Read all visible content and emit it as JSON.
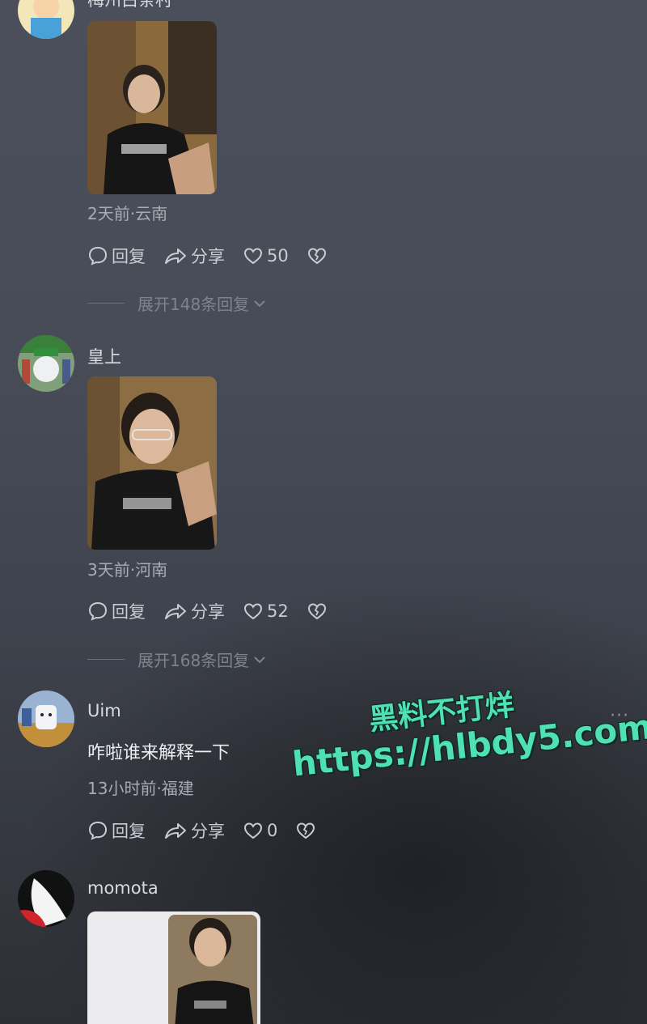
{
  "comments": [
    {
      "username": "梅州白条村",
      "meta": "2天前·云南",
      "actions": {
        "reply": "回复",
        "share": "分享",
        "likes": "50"
      },
      "expand": "展开148条回复"
    },
    {
      "username": "皇上",
      "meta": "3天前·河南",
      "actions": {
        "reply": "回复",
        "share": "分享",
        "likes": "52"
      },
      "expand": "展开168条回复"
    },
    {
      "username": "Uim",
      "text": "咋啦谁来解释一下",
      "meta": "13小时前·福建",
      "actions": {
        "reply": "回复",
        "share": "分享",
        "likes": "0"
      },
      "more": "···"
    },
    {
      "username": "momota"
    }
  ],
  "watermark": {
    "line1": "黑料不打烊",
    "line2": "https://hlbdy5.com"
  },
  "colors": {
    "watermark": "#4fe0b3",
    "background_top": "#4a4f5b",
    "background_bottom": "#2d2f35"
  }
}
